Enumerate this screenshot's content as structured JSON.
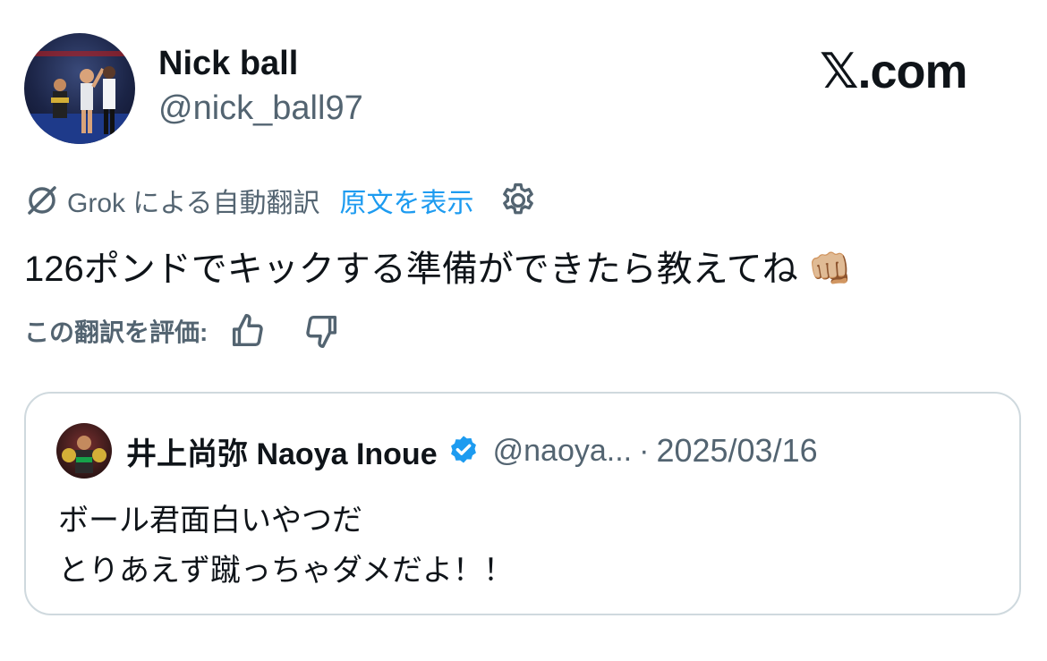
{
  "author": {
    "name": "Nick ball",
    "handle": "@nick_ball97",
    "avatar_icon": "boxer-photo-avatar"
  },
  "brand": {
    "label": "𝕏.com",
    "icon": "x-logo-icon"
  },
  "translation": {
    "label": "Grok による自動翻訳",
    "show_original": "原文を表示",
    "settings_icon": "gear-icon",
    "link_color": "#1d9bf0"
  },
  "tweet": {
    "text": "126ポンドでキックする準備ができたら教えてね 👊🏼"
  },
  "rating": {
    "label": "この翻訳を評価:",
    "thumbs_up_icon": "thumbs-up-icon",
    "thumbs_down_icon": "thumbs-down-icon"
  },
  "quote": {
    "name": "井上尚弥  Naoya Inoue",
    "handle": "@naoya...",
    "separator": "·",
    "date": "2025/03/16",
    "verified_color": "#1d9bf0",
    "lines": [
      "ボール君面白いやつだ",
      "とりあえず蹴っちゃダメだよ！！"
    ]
  }
}
